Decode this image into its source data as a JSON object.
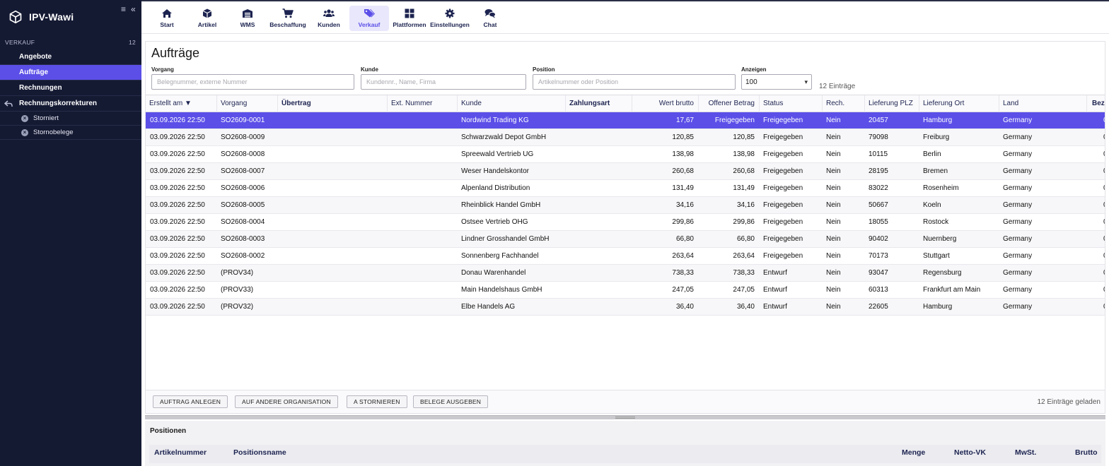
{
  "app": {
    "title": "IPV-Wawi"
  },
  "sidebar": {
    "section": {
      "label": "VERKAUF",
      "count": "12"
    },
    "items": [
      {
        "label": "Angebote",
        "active": false
      },
      {
        "label": "Aufträge",
        "active": true
      },
      {
        "label": "Rechnungen",
        "active": false
      },
      {
        "label": "Rechnungskorrekturen",
        "active": false
      }
    ],
    "subitems": [
      {
        "label": "Storniert"
      },
      {
        "label": "Stornobelege"
      }
    ]
  },
  "toolbar": {
    "items": [
      {
        "label": "Start",
        "icon": "home-icon"
      },
      {
        "label": "Artikel",
        "icon": "box-icon"
      },
      {
        "label": "WMS",
        "icon": "warehouse-icon"
      },
      {
        "label": "Beschaffung",
        "icon": "cart-icon"
      },
      {
        "label": "Kunden",
        "icon": "users-icon"
      },
      {
        "label": "Verkauf",
        "icon": "tags-icon",
        "active": true
      },
      {
        "label": "Plattformen",
        "icon": "grid-icon"
      },
      {
        "label": "Einstellungen",
        "icon": "gear-icon"
      },
      {
        "label": "Chat",
        "icon": "chat-icon"
      }
    ]
  },
  "main": {
    "title": "Aufträge",
    "filters": {
      "vorgang": {
        "label": "Vorgang",
        "placeholder": "Belegnummer, externe Nummer"
      },
      "kunde": {
        "label": "Kunde",
        "placeholder": "Kundennr., Name, Firma"
      },
      "position": {
        "label": "Position",
        "placeholder": "Artikelnummer oder Position"
      },
      "anzeigen": {
        "label": "Anzeigen",
        "value": "100"
      }
    },
    "count_text": "12 Einträge",
    "columns": {
      "created": "Erstellt am ▼",
      "vorgang": "Vorgang",
      "uebertrag": "Übertrag",
      "ext": "Ext. Nummer",
      "kunde": "Kunde",
      "zahlungsart": "Zahlungsart",
      "wert": "Wert brutto",
      "offen": "Offener Betrag",
      "status": "Status",
      "rech": "Rech.",
      "plz": "Lieferung PLZ",
      "ort": "Lieferung Ort",
      "land": "Land",
      "bez": "Bez"
    },
    "rows": [
      {
        "created": "03.09.2026 22:50",
        "vorgang": "SO2609-0001",
        "kunde": "Nordwind Trading KG",
        "wert": "17,67",
        "offen": "Freigegeben",
        "status": "Freigegeben",
        "rech": "Nein",
        "plz": "20457",
        "ort": "Hamburg",
        "land": "Germany",
        "bez": "0"
      },
      {
        "created": "03.09.2026 22:50",
        "vorgang": "SO2608-0009",
        "kunde": "Schwarzwald Depot GmbH",
        "wert": "120,85",
        "offen": "120,85",
        "status": "Freigegeben",
        "rech": "Nein",
        "plz": "79098",
        "ort": "Freiburg",
        "land": "Germany",
        "bez": "0"
      },
      {
        "created": "03.09.2026 22:50",
        "vorgang": "SO2608-0008",
        "kunde": "Spreewald Vertrieb UG",
        "wert": "138,98",
        "offen": "138,98",
        "status": "Freigegeben",
        "rech": "Nein",
        "plz": "10115",
        "ort": "Berlin",
        "land": "Germany",
        "bez": "0"
      },
      {
        "created": "03.09.2026 22:50",
        "vorgang": "SO2608-0007",
        "kunde": "Weser Handelskontor",
        "wert": "260,68",
        "offen": "260,68",
        "status": "Freigegeben",
        "rech": "Nein",
        "plz": "28195",
        "ort": "Bremen",
        "land": "Germany",
        "bez": "0"
      },
      {
        "created": "03.09.2026 22:50",
        "vorgang": "SO2608-0006",
        "kunde": "Alpenland Distribution",
        "wert": "131,49",
        "offen": "131,49",
        "status": "Freigegeben",
        "rech": "Nein",
        "plz": "83022",
        "ort": "Rosenheim",
        "land": "Germany",
        "bez": "0"
      },
      {
        "created": "03.09.2026 22:50",
        "vorgang": "SO2608-0005",
        "kunde": "Rheinblick Handel GmbH",
        "wert": "34,16",
        "offen": "34,16",
        "status": "Freigegeben",
        "rech": "Nein",
        "plz": "50667",
        "ort": "Koeln",
        "land": "Germany",
        "bez": "0"
      },
      {
        "created": "03.09.2026 22:50",
        "vorgang": "SO2608-0004",
        "kunde": "Ostsee Vertrieb OHG",
        "wert": "299,86",
        "offen": "299,86",
        "status": "Freigegeben",
        "rech": "Nein",
        "plz": "18055",
        "ort": "Rostock",
        "land": "Germany",
        "bez": "0"
      },
      {
        "created": "03.09.2026 22:50",
        "vorgang": "SO2608-0003",
        "kunde": "Lindner Grosshandel GmbH",
        "wert": "66,80",
        "offen": "66,80",
        "status": "Freigegeben",
        "rech": "Nein",
        "plz": "90402",
        "ort": "Nuernberg",
        "land": "Germany",
        "bez": "0"
      },
      {
        "created": "03.09.2026 22:50",
        "vorgang": "SO2608-0002",
        "kunde": "Sonnenberg Fachhandel",
        "wert": "263,64",
        "offen": "263,64",
        "status": "Freigegeben",
        "rech": "Nein",
        "plz": "70173",
        "ort": "Stuttgart",
        "land": "Germany",
        "bez": "0"
      },
      {
        "created": "03.09.2026 22:50",
        "vorgang": "(PROV34)",
        "kunde": "Donau Warenhandel",
        "wert": "738,33",
        "offen": "738,33",
        "status": "Entwurf",
        "rech": "Nein",
        "plz": "93047",
        "ort": "Regensburg",
        "land": "Germany",
        "bez": "0"
      },
      {
        "created": "03.09.2026 22:50",
        "vorgang": "(PROV33)",
        "kunde": "Main Handelshaus GmbH",
        "wert": "247,05",
        "offen": "247,05",
        "status": "Entwurf",
        "rech": "Nein",
        "plz": "60313",
        "ort": "Frankfurt am Main",
        "land": "Germany",
        "bez": "0"
      },
      {
        "created": "03.09.2026 22:50",
        "vorgang": "(PROV32)",
        "kunde": "Elbe Handels AG",
        "wert": "36,40",
        "offen": "36,40",
        "status": "Entwurf",
        "rech": "Nein",
        "plz": "22605",
        "ort": "Hamburg",
        "land": "Germany",
        "bez": "0"
      }
    ],
    "buttons": {
      "anlegen": "AUFTRAG ANLEGEN",
      "organisation": "AUF ANDERE ORGANISATION",
      "stornieren": "A STORNIEREN",
      "belege": "BELEGE AUSGEBEN"
    },
    "loaded_text": "12 Einträge geladen"
  },
  "positions": {
    "title": "Positionen",
    "columns": {
      "artikelnummer": "Artikelnummer",
      "positionsname": "Positionsname",
      "menge": "Menge",
      "netto": "Netto-VK",
      "mwst": "MwSt.",
      "brutto": "Brutto"
    }
  },
  "colors": {
    "sidebar_bg": "#151a33",
    "accent": "#5b4fe8",
    "nav_text": "#1d2450"
  }
}
